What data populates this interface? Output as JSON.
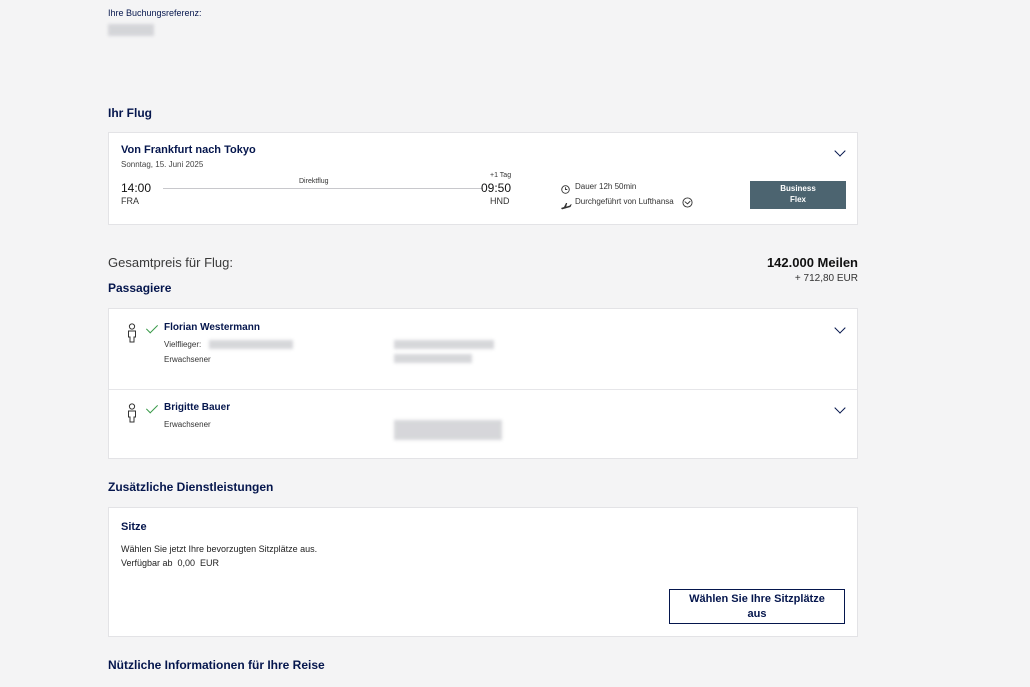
{
  "booking": {
    "reference_label": "Ihre Buchungsreferenz:"
  },
  "flight_section": {
    "title": "Ihr Flug"
  },
  "flight": {
    "route": "Von Frankfurt nach Tokyo",
    "date": "Sonntag, 15. Juni 2025",
    "departure_time": "14:00",
    "departure_airport": "FRA",
    "stop_label": "Direktflug",
    "day_offset": "+1 Tag",
    "arrival_time": "09:50",
    "arrival_airport": "HND",
    "duration": "Dauer 12h 50min",
    "operated_by": "Durchgeführt von Lufthansa",
    "fare_line1": "Business",
    "fare_line2": "Flex"
  },
  "price": {
    "label": "Gesamtpreis für Flug:",
    "miles": "142.000 Meilen",
    "eur": "+ 712,80 EUR"
  },
  "passengers_section": {
    "title": "Passagiere"
  },
  "passengers": [
    {
      "name": "Florian Westermann",
      "frequent_flyer_label": "Vielflieger:",
      "type": "Erwachsener"
    },
    {
      "name": "Brigitte Bauer",
      "type": "Erwachsener"
    }
  ],
  "services_section": {
    "title": "Zusätzliche Dienstleistungen"
  },
  "seats": {
    "title": "Sitze",
    "description": "Wählen Sie jetzt Ihre bevorzugten Sitzplätze aus.",
    "availability": "Verfügbar ab  0,00  EUR",
    "button_line1": "Wählen Sie Ihre Sitzplätze",
    "button_line2": "aus"
  },
  "info_section": {
    "title": "Nützliche Informationen für Ihre Reise"
  }
}
